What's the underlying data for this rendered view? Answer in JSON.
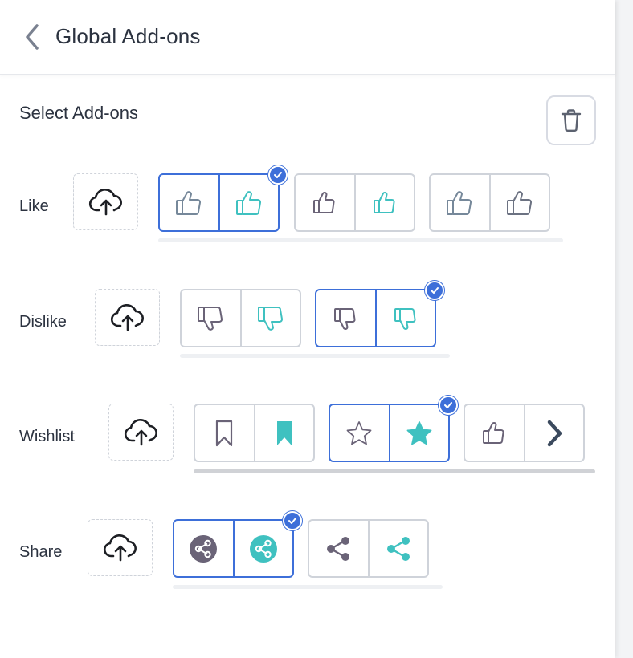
{
  "header": {
    "title": "Global Add-ons"
  },
  "section": {
    "title": "Select Add-ons"
  },
  "rows": [
    {
      "label": "Like"
    },
    {
      "label": "Dislike"
    },
    {
      "label": "Wishlist"
    },
    {
      "label": "Share"
    }
  ],
  "colors": {
    "accent": "#3d6fd9",
    "teal": "#3fc1c0",
    "gray_icon": "#6c7282",
    "dark_icon": "#6a6377",
    "slate": "#76889a"
  },
  "icons": {
    "back": "chevron-left-icon",
    "trash": "trash-icon",
    "upload": "cloud-upload-icon",
    "selected": "check-circle-icon"
  }
}
